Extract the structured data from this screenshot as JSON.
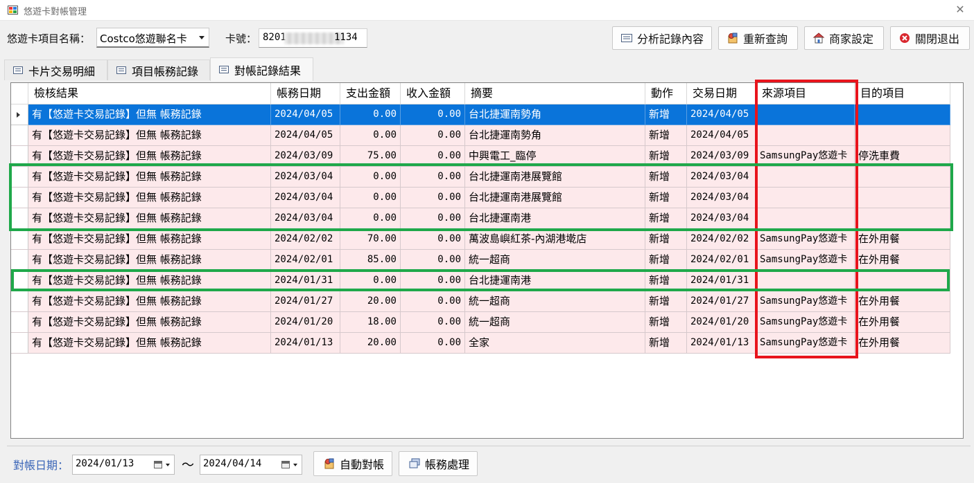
{
  "window": {
    "title": "悠遊卡對帳管理",
    "close_glyph": "✕"
  },
  "header": {
    "project_label": "悠遊卡項目名稱：",
    "project_value": "Costco悠遊聯名卡",
    "card_label": "卡號：",
    "card_prefix": "8201",
    "card_suffix": "1134"
  },
  "toolbar": {
    "analyze": "分析記錄內容",
    "requery": "重新查詢",
    "merchant": "商家設定",
    "close": "關閉退出"
  },
  "tabs": [
    {
      "label": "卡片交易明細",
      "active": false
    },
    {
      "label": "項目帳務記錄",
      "active": false
    },
    {
      "label": "對帳記錄結果",
      "active": true
    }
  ],
  "grid": {
    "columns": [
      "檢核結果",
      "帳務日期",
      "支出金額",
      "收入金額",
      "摘要",
      "動作",
      "交易日期",
      "來源項目",
      "目的項目"
    ],
    "rows": [
      [
        "有【悠遊卡交易記錄】但無 帳務記錄",
        "2024/04/05",
        "0.00",
        "0.00",
        "台北捷運南勢角",
        "新增",
        "2024/04/05",
        "",
        ""
      ],
      [
        "有【悠遊卡交易記錄】但無 帳務記錄",
        "2024/04/05",
        "0.00",
        "0.00",
        "台北捷運南勢角",
        "新增",
        "2024/04/05",
        "",
        ""
      ],
      [
        "有【悠遊卡交易記錄】但無 帳務記錄",
        "2024/03/09",
        "75.00",
        "0.00",
        "中興電工_臨停",
        "新增",
        "2024/03/09",
        "SamsungPay悠遊卡",
        "停洗車費"
      ],
      [
        "有【悠遊卡交易記錄】但無 帳務記錄",
        "2024/03/04",
        "0.00",
        "0.00",
        "台北捷運南港展覽館",
        "新增",
        "2024/03/04",
        "",
        ""
      ],
      [
        "有【悠遊卡交易記錄】但無 帳務記錄",
        "2024/03/04",
        "0.00",
        "0.00",
        "台北捷運南港展覽館",
        "新增",
        "2024/03/04",
        "",
        ""
      ],
      [
        "有【悠遊卡交易記錄】但無 帳務記錄",
        "2024/03/04",
        "0.00",
        "0.00",
        "台北捷運南港",
        "新增",
        "2024/03/04",
        "",
        ""
      ],
      [
        "有【悠遊卡交易記錄】但無 帳務記錄",
        "2024/02/02",
        "70.00",
        "0.00",
        "萬波島嶼紅茶-內湖港墘店",
        "新增",
        "2024/02/02",
        "SamsungPay悠遊卡",
        "在外用餐"
      ],
      [
        "有【悠遊卡交易記錄】但無 帳務記錄",
        "2024/02/01",
        "85.00",
        "0.00",
        "統一超商",
        "新增",
        "2024/02/01",
        "SamsungPay悠遊卡",
        "在外用餐"
      ],
      [
        "有【悠遊卡交易記錄】但無 帳務記錄",
        "2024/01/31",
        "0.00",
        "0.00",
        "台北捷運南港",
        "新增",
        "2024/01/31",
        "",
        ""
      ],
      [
        "有【悠遊卡交易記錄】但無 帳務記錄",
        "2024/01/27",
        "20.00",
        "0.00",
        "統一超商",
        "新增",
        "2024/01/27",
        "SamsungPay悠遊卡",
        "在外用餐"
      ],
      [
        "有【悠遊卡交易記錄】但無 帳務記錄",
        "2024/01/20",
        "18.00",
        "0.00",
        "統一超商",
        "新增",
        "2024/01/20",
        "SamsungPay悠遊卡",
        "在外用餐"
      ],
      [
        "有【悠遊卡交易記錄】但無 帳務記錄",
        "2024/01/13",
        "20.00",
        "0.00",
        "全家",
        "新增",
        "2024/01/13",
        "SamsungPay悠遊卡",
        "在外用餐"
      ]
    ]
  },
  "footer": {
    "date_label": "對帳日期：",
    "date_from": "2024/01/13",
    "tilde": "～",
    "date_to": "2024/04/14",
    "auto_reconcile": "自動對帳",
    "accounting": "帳務處理"
  },
  "colors": {
    "selected_row": "#0a74da",
    "row_bg": "#fde9eb",
    "highlight_red": "#e8141c",
    "highlight_green": "#1fa84a",
    "label_blue": "#3b66b8"
  }
}
